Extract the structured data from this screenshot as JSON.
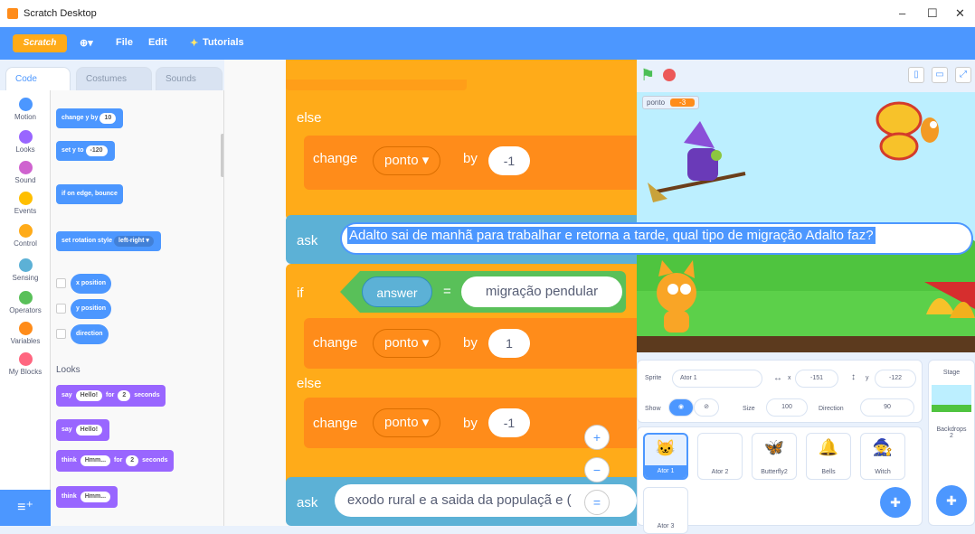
{
  "window": {
    "title": "Scratch Desktop",
    "minimize": "–",
    "maximize": "☐",
    "close": "✕"
  },
  "menubar": {
    "logo": "Scratch",
    "globe": "⊕▾",
    "file": "File",
    "edit": "Edit",
    "tutorials": "Tutorials"
  },
  "tabs": {
    "code": "Code",
    "costumes": "Costumes",
    "sounds": "Sounds"
  },
  "categories": [
    {
      "label": "Motion",
      "color": "#4c97ff"
    },
    {
      "label": "Looks",
      "color": "#9966ff"
    },
    {
      "label": "Sound",
      "color": "#cf63cf"
    },
    {
      "label": "Events",
      "color": "#ffbf00"
    },
    {
      "label": "Control",
      "color": "#ffab19"
    },
    {
      "label": "Sensing",
      "color": "#5cb1d6"
    },
    {
      "label": "Operators",
      "color": "#59c059"
    },
    {
      "label": "Variables",
      "color": "#ff8c1a"
    },
    {
      "label": "My Blocks",
      "color": "#ff6680"
    }
  ],
  "palette": {
    "change_y": {
      "pre": "change y by",
      "val": "10"
    },
    "set_y": {
      "pre": "set y to",
      "val": "-120"
    },
    "bounce": "if on edge, bounce",
    "rotation": {
      "pre": "set rotation style",
      "val": "left-right ▾"
    },
    "x_position": "x position",
    "y_position": "y position",
    "direction": "direction",
    "looks_heading": "Looks",
    "say_for": {
      "pre": "say",
      "msg": "Hello!",
      "mid": "for",
      "secs": "2",
      "post": "seconds"
    },
    "say": {
      "pre": "say",
      "msg": "Hello!"
    },
    "think_for": {
      "pre": "think",
      "msg": "Hmm...",
      "mid": "for",
      "secs": "2",
      "post": "seconds"
    },
    "think": {
      "pre": "think",
      "msg": "Hmm..."
    }
  },
  "script": {
    "else1": "else",
    "change1": {
      "label": "change",
      "var": "ponto ▾",
      "by": "by",
      "val": "-1"
    },
    "ask1": {
      "label": "ask"
    },
    "if": {
      "label": "if",
      "answer": "answer",
      "eq": "=",
      "value": "migração pendular"
    },
    "change2": {
      "label": "change",
      "var": "ponto ▾",
      "by": "by",
      "val": "1"
    },
    "else2": "else",
    "change3": {
      "label": "change",
      "var": "ponto ▾",
      "by": "by",
      "val": "-1"
    },
    "ask2": {
      "label": "ask",
      "text": "exodo rural e a saida da populaçã",
      "tail": "e ("
    },
    "zoom_in": "+",
    "zoom_out": "−",
    "zoom_reset": "="
  },
  "ask_bubble": "Adalto sai de manhã para trabalhar e retorna a tarde, qual tipo de migração Adalto faz?",
  "stage": {
    "monitor_label": "ponto",
    "monitor_value": "-3",
    "flag": "⚑"
  },
  "sprite_info": {
    "sprite_label": "Sprite",
    "sprite_name": "Ator 1",
    "x_label": "x",
    "x_value": "-151",
    "y_label": "y",
    "y_value": "-122",
    "show_label": "Show",
    "size_label": "Size",
    "size_value": "100",
    "direction_label": "Direction",
    "direction_value": "90"
  },
  "sprites": [
    {
      "name": "Ator 1",
      "icon": "🐱",
      "selected": true
    },
    {
      "name": "Ator 2",
      "icon": "",
      "selected": false
    },
    {
      "name": "Butterfly2",
      "icon": "🦋",
      "selected": false
    },
    {
      "name": "Bells",
      "icon": "🔔",
      "selected": false
    },
    {
      "name": "Witch",
      "icon": "🧙",
      "selected": false
    },
    {
      "name": "Ator 3",
      "icon": "",
      "selected": false
    }
  ],
  "stage_panel": {
    "label": "Stage",
    "backdrops_label": "Backdrops",
    "backdrops_count": "2"
  }
}
